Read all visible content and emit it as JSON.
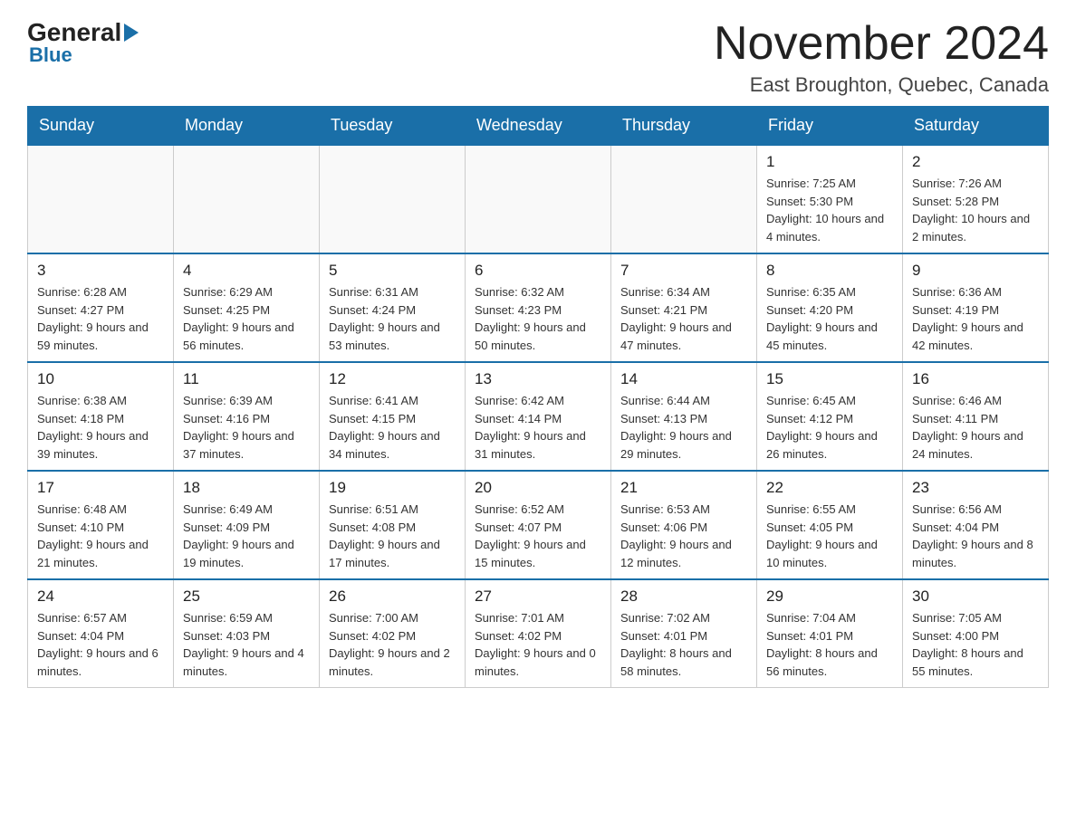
{
  "header": {
    "logo": {
      "general": "General",
      "blue": "Blue"
    },
    "title": "November 2024",
    "location": "East Broughton, Quebec, Canada"
  },
  "calendar": {
    "days_of_week": [
      "Sunday",
      "Monday",
      "Tuesday",
      "Wednesday",
      "Thursday",
      "Friday",
      "Saturday"
    ],
    "weeks": [
      [
        {
          "day": "",
          "info": ""
        },
        {
          "day": "",
          "info": ""
        },
        {
          "day": "",
          "info": ""
        },
        {
          "day": "",
          "info": ""
        },
        {
          "day": "",
          "info": ""
        },
        {
          "day": "1",
          "info": "Sunrise: 7:25 AM\nSunset: 5:30 PM\nDaylight: 10 hours and 4 minutes."
        },
        {
          "day": "2",
          "info": "Sunrise: 7:26 AM\nSunset: 5:28 PM\nDaylight: 10 hours and 2 minutes."
        }
      ],
      [
        {
          "day": "3",
          "info": "Sunrise: 6:28 AM\nSunset: 4:27 PM\nDaylight: 9 hours and 59 minutes."
        },
        {
          "day": "4",
          "info": "Sunrise: 6:29 AM\nSunset: 4:25 PM\nDaylight: 9 hours and 56 minutes."
        },
        {
          "day": "5",
          "info": "Sunrise: 6:31 AM\nSunset: 4:24 PM\nDaylight: 9 hours and 53 minutes."
        },
        {
          "day": "6",
          "info": "Sunrise: 6:32 AM\nSunset: 4:23 PM\nDaylight: 9 hours and 50 minutes."
        },
        {
          "day": "7",
          "info": "Sunrise: 6:34 AM\nSunset: 4:21 PM\nDaylight: 9 hours and 47 minutes."
        },
        {
          "day": "8",
          "info": "Sunrise: 6:35 AM\nSunset: 4:20 PM\nDaylight: 9 hours and 45 minutes."
        },
        {
          "day": "9",
          "info": "Sunrise: 6:36 AM\nSunset: 4:19 PM\nDaylight: 9 hours and 42 minutes."
        }
      ],
      [
        {
          "day": "10",
          "info": "Sunrise: 6:38 AM\nSunset: 4:18 PM\nDaylight: 9 hours and 39 minutes."
        },
        {
          "day": "11",
          "info": "Sunrise: 6:39 AM\nSunset: 4:16 PM\nDaylight: 9 hours and 37 minutes."
        },
        {
          "day": "12",
          "info": "Sunrise: 6:41 AM\nSunset: 4:15 PM\nDaylight: 9 hours and 34 minutes."
        },
        {
          "day": "13",
          "info": "Sunrise: 6:42 AM\nSunset: 4:14 PM\nDaylight: 9 hours and 31 minutes."
        },
        {
          "day": "14",
          "info": "Sunrise: 6:44 AM\nSunset: 4:13 PM\nDaylight: 9 hours and 29 minutes."
        },
        {
          "day": "15",
          "info": "Sunrise: 6:45 AM\nSunset: 4:12 PM\nDaylight: 9 hours and 26 minutes."
        },
        {
          "day": "16",
          "info": "Sunrise: 6:46 AM\nSunset: 4:11 PM\nDaylight: 9 hours and 24 minutes."
        }
      ],
      [
        {
          "day": "17",
          "info": "Sunrise: 6:48 AM\nSunset: 4:10 PM\nDaylight: 9 hours and 21 minutes."
        },
        {
          "day": "18",
          "info": "Sunrise: 6:49 AM\nSunset: 4:09 PM\nDaylight: 9 hours and 19 minutes."
        },
        {
          "day": "19",
          "info": "Sunrise: 6:51 AM\nSunset: 4:08 PM\nDaylight: 9 hours and 17 minutes."
        },
        {
          "day": "20",
          "info": "Sunrise: 6:52 AM\nSunset: 4:07 PM\nDaylight: 9 hours and 15 minutes."
        },
        {
          "day": "21",
          "info": "Sunrise: 6:53 AM\nSunset: 4:06 PM\nDaylight: 9 hours and 12 minutes."
        },
        {
          "day": "22",
          "info": "Sunrise: 6:55 AM\nSunset: 4:05 PM\nDaylight: 9 hours and 10 minutes."
        },
        {
          "day": "23",
          "info": "Sunrise: 6:56 AM\nSunset: 4:04 PM\nDaylight: 9 hours and 8 minutes."
        }
      ],
      [
        {
          "day": "24",
          "info": "Sunrise: 6:57 AM\nSunset: 4:04 PM\nDaylight: 9 hours and 6 minutes."
        },
        {
          "day": "25",
          "info": "Sunrise: 6:59 AM\nSunset: 4:03 PM\nDaylight: 9 hours and 4 minutes."
        },
        {
          "day": "26",
          "info": "Sunrise: 7:00 AM\nSunset: 4:02 PM\nDaylight: 9 hours and 2 minutes."
        },
        {
          "day": "27",
          "info": "Sunrise: 7:01 AM\nSunset: 4:02 PM\nDaylight: 9 hours and 0 minutes."
        },
        {
          "day": "28",
          "info": "Sunrise: 7:02 AM\nSunset: 4:01 PM\nDaylight: 8 hours and 58 minutes."
        },
        {
          "day": "29",
          "info": "Sunrise: 7:04 AM\nSunset: 4:01 PM\nDaylight: 8 hours and 56 minutes."
        },
        {
          "day": "30",
          "info": "Sunrise: 7:05 AM\nSunset: 4:00 PM\nDaylight: 8 hours and 55 minutes."
        }
      ]
    ]
  }
}
